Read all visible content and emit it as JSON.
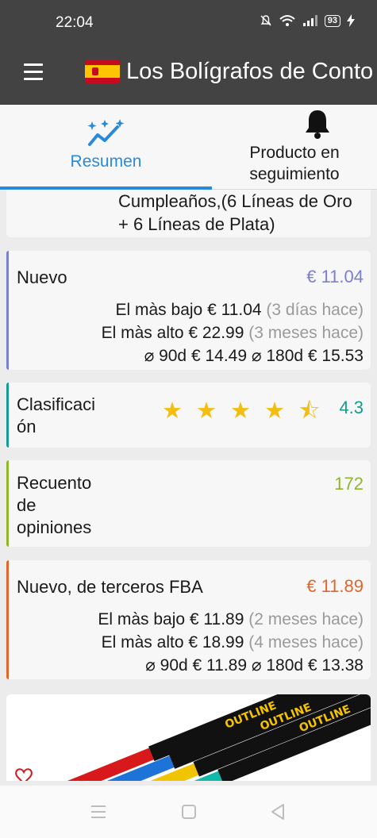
{
  "status_bar": {
    "time": "22:04",
    "battery": "93"
  },
  "app_bar": {
    "title": "Los Bolígrafos de Conto"
  },
  "tabs": [
    {
      "label": "Resumen",
      "icon": "sparkle-chart-icon",
      "active": true
    },
    {
      "label": "Producto en\nseguimiento",
      "icon": "bell-icon",
      "active": false
    }
  ],
  "description_card": {
    "line1": "Cumpleaños,(6 Líneas de Oro",
    "line2": "+ 6 Líneas de Plata)"
  },
  "new_card": {
    "title": "Nuevo",
    "value": "€ 11.04",
    "accent": "#7b7fd1",
    "lowest_label": "El màs bajo",
    "lowest_price": "€ 11.04",
    "lowest_when": "(3 días hace)",
    "highest_label": "El màs alto",
    "highest_price": "€ 22.99",
    "highest_when": "(3 meses hace)",
    "avg90_label": "⌀ 90d",
    "avg90": "€ 14.49",
    "avg180_label": "⌀ 180d",
    "avg180": "€ 15.53"
  },
  "rating_card": {
    "title_l1": "Clasificaci",
    "title_l2": "ón",
    "stars": "★★★★⯪",
    "rating": 4.3,
    "value": "4.3",
    "accent": "#159b8f"
  },
  "reviews_card": {
    "title_l1": "Recuento",
    "title_l2": "de",
    "title_l3": "opiniones",
    "value": "172",
    "accent": "#8fb52a"
  },
  "fba_card": {
    "title": "Nuevo, de terceros FBA",
    "value": "€ 11.89",
    "accent": "#e0662c",
    "lowest_label": "El màs bajo",
    "lowest_price": "€ 11.89",
    "lowest_when": "(2 meses hace)",
    "highest_label": "El màs alto",
    "highest_price": "€ 18.99",
    "highest_when": "(4 meses hace)",
    "avg90_label": "⌀ 90d",
    "avg90": "€ 11.89",
    "avg180_label": "⌀ 180d",
    "avg180": "€ 13.38"
  },
  "product_image": {
    "brand_text": "OUTLINE"
  },
  "nav_bar": {
    "buttons": [
      "menu",
      "home",
      "back"
    ]
  }
}
